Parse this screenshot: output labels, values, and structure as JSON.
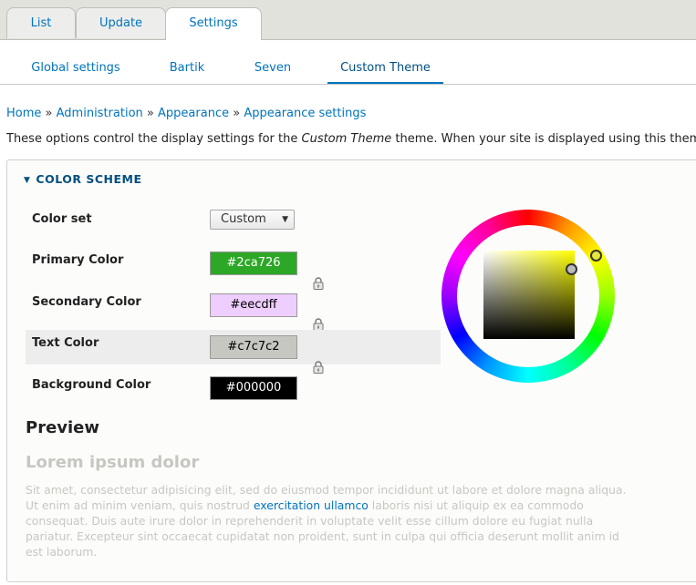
{
  "primary_tabs": {
    "list": "List",
    "update": "Update",
    "settings": "Settings"
  },
  "secondary_tabs": {
    "global": "Global settings",
    "bartik": "Bartik",
    "seven": "Seven",
    "custom": "Custom Theme"
  },
  "breadcrumb": {
    "items": [
      "Home",
      "Administration",
      "Appearance",
      "Appearance settings"
    ],
    "separator": "»"
  },
  "intro": {
    "before": "These options control the display settings for the ",
    "theme": "Custom Theme",
    "after": " theme. When your site is displayed using this theme"
  },
  "color_scheme": {
    "legend": "COLOR SCHEME",
    "color_set": {
      "label": "Color set",
      "value": "Custom"
    },
    "fields": [
      {
        "label": "Primary Color",
        "value": "#2ca726",
        "bg": "#2ca726",
        "fg": "#ffffff"
      },
      {
        "label": "Secondary Color",
        "value": "#eecdff",
        "bg": "#eecdff",
        "fg": "#000000"
      },
      {
        "label": "Text Color",
        "value": "#c7c7c2",
        "bg": "#c7c7c2",
        "fg": "#000000"
      },
      {
        "label": "Background Color",
        "value": "#000000",
        "bg": "#000000",
        "fg": "#ffffff"
      }
    ]
  },
  "preview": {
    "title": "Preview",
    "heading": "Lorem ipsum dolor",
    "text_before": "Sit amet, consectetur adipisicing elit, sed do eiusmod tempor incididunt ut labore et dolore magna aliqua. Ut enim ad minim veniam, quis nostrud ",
    "link": "exercitation ullamco",
    "text_after": " laboris nisi ut aliquip ex ea commodo consequat. Duis aute irure dolor in reprehenderit in voluptate velit esse cillum dolore eu fugiat nulla pariatur. Excepteur sint occaecat cupidatat non proident, sunt in culpa qui officia deserunt mollit anim id est laborum."
  }
}
